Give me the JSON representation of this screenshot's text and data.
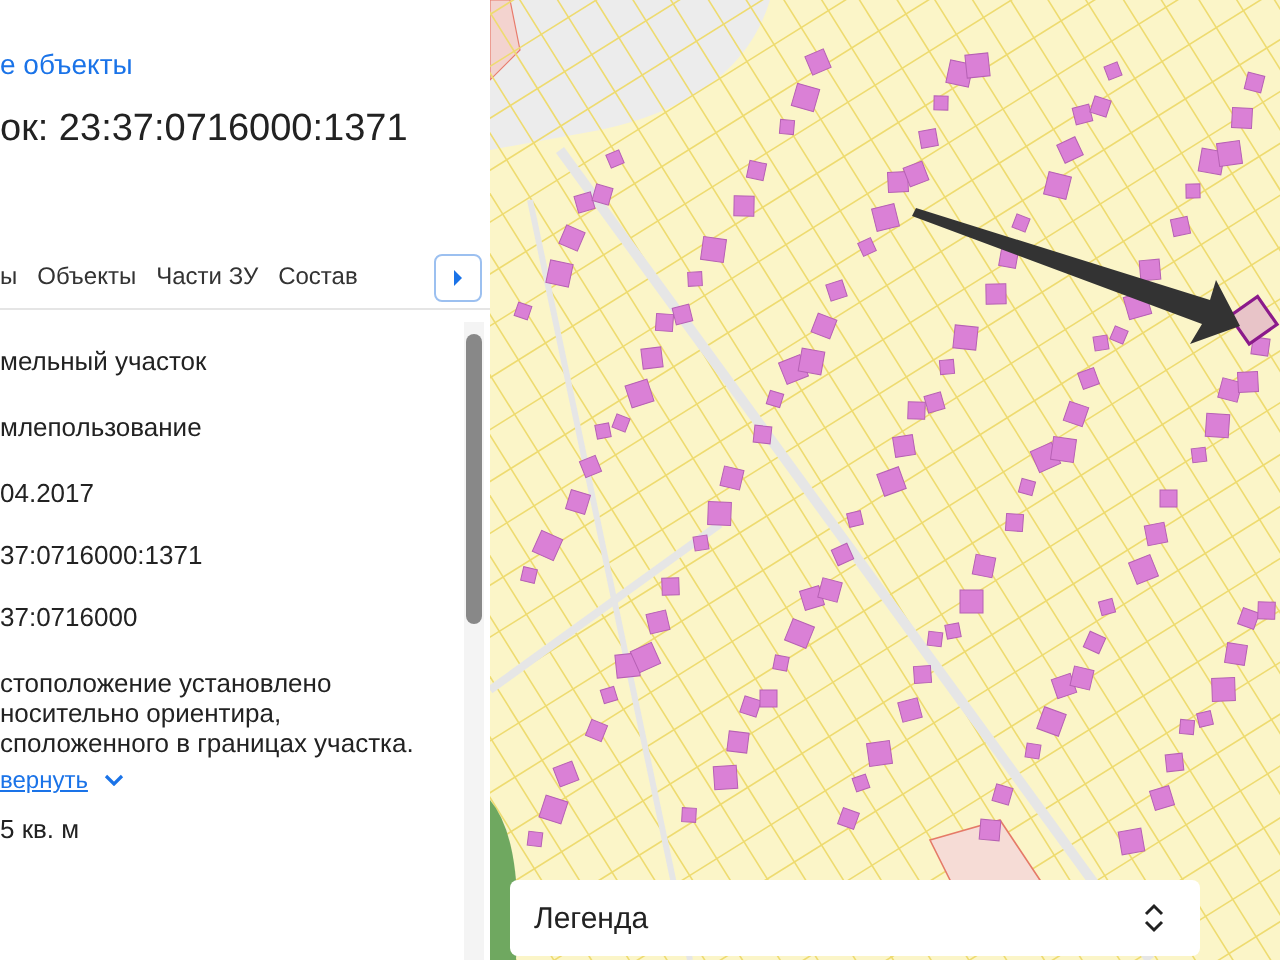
{
  "panel": {
    "link": "е объекты",
    "title": "ок: 23:37:0716000:1371",
    "tabs": [
      {
        "label": "ы",
        "selected": false
      },
      {
        "label": "Объекты",
        "selected": false
      },
      {
        "label": "Части ЗУ",
        "selected": false
      },
      {
        "label": "Состав",
        "selected": false
      }
    ],
    "fields": [
      {
        "kind": "text",
        "value": "мельный участок"
      },
      {
        "kind": "text",
        "value": "млепользование"
      },
      {
        "kind": "text",
        "value": "04.2017"
      },
      {
        "kind": "text",
        "value": "37:0716000:1371"
      },
      {
        "kind": "text",
        "value": "37:0716000"
      },
      {
        "kind": "paragraph",
        "value": "стоположение установлено носительно ориентира, сположенного в границах участка.",
        "link": "вернуть"
      },
      {
        "kind": "text",
        "value": "5 кв. м"
      }
    ]
  },
  "map": {
    "legend": {
      "label": "Легенда"
    }
  }
}
